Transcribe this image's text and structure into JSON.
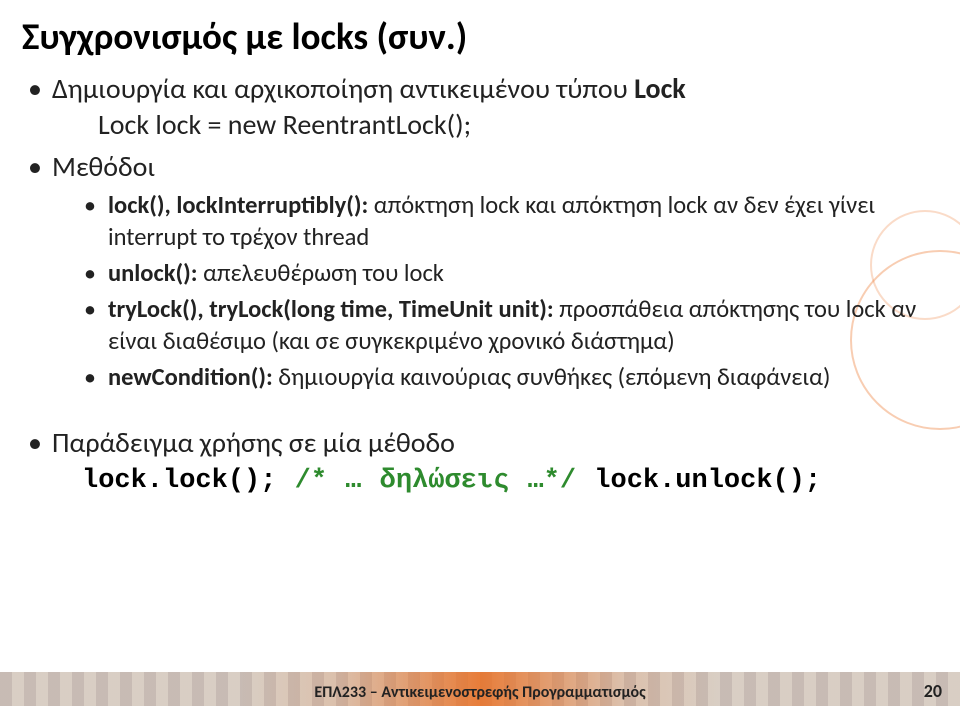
{
  "title": "Συγχρονισμός με locks (συν.)",
  "bullets": {
    "b1": {
      "label": "Δημιουργία και αρχικοποίηση αντικειμένου τύπου ",
      "bold_end": "Lock"
    },
    "b1_code": "Lock lock = new ReentrantLock();",
    "b2": "Μεθόδοι",
    "m1": {
      "bold": "lock(), lockInterruptibly(): ",
      "rest": "απόκτηση lock και απόκτηση lock αν δεν έχει γίνει interrupt το τρέχον thread"
    },
    "m2": {
      "bold": "unlock(): ",
      "rest": "απελευθέρωση του lock"
    },
    "m3": {
      "bold": "tryLock(), tryLock(long time, TimeUnit unit): ",
      "rest": "προσπάθεια απόκτησης του lock αν είναι διαθέσιμο (και σε συγκεκριμένο χρονικό διάστημα)"
    },
    "m4": {
      "bold": "newCondition(): ",
      "rest": "δημιουργία καινούριας συνθήκες (επόμενη διαφάνεια)"
    },
    "b3": "Παράδειγμα χρήσης σε μία μέθοδο",
    "codeline": {
      "p1": "lock.lock();",
      "gap1": "  ",
      "cm": "/* … δηλώσεις …*/",
      "gap2": "  ",
      "p2": "lock.unlock();"
    }
  },
  "footer": {
    "course": "ΕΠΛ233 – Αντικειμενοστρεφής Προγραμματισμός",
    "page": "20"
  }
}
